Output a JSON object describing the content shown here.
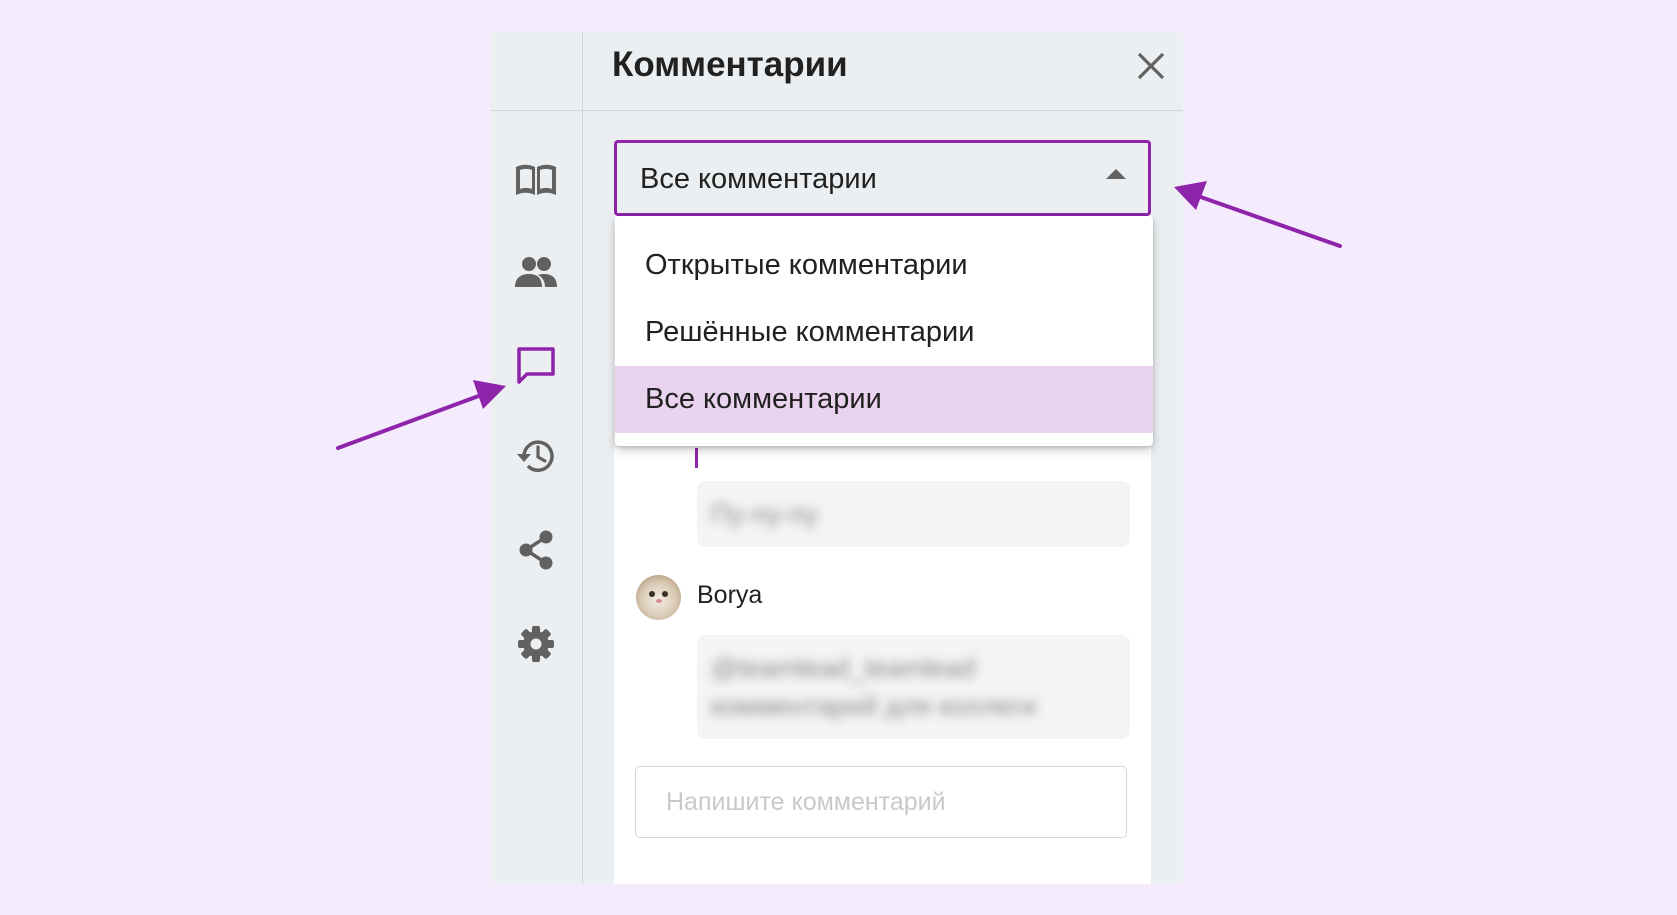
{
  "colors": {
    "page_background": "#f4ebfd",
    "accent": "#8e24aa",
    "selected_item": "#ead3ee",
    "icon": "#616161",
    "annotation_arrow": "#8e24aa"
  },
  "panel": {
    "title": "Комментарии",
    "close_icon": "close-icon"
  },
  "sidebar": {
    "items": [
      {
        "icon": "book-icon",
        "active": false
      },
      {
        "icon": "people-icon",
        "active": false
      },
      {
        "icon": "comment-icon",
        "active": true
      },
      {
        "icon": "history-icon",
        "active": false
      },
      {
        "icon": "share-icon",
        "active": false
      },
      {
        "icon": "settings-icon",
        "active": false
      }
    ]
  },
  "filter": {
    "selected": "Все комментарии",
    "options": [
      {
        "label": "Открытые комментарии",
        "selected": false
      },
      {
        "label": "Решённые комментарии",
        "selected": false
      },
      {
        "label": "Все комментарии",
        "selected": true
      }
    ]
  },
  "comments": [
    {
      "author": "",
      "text": "Пу-пу-пу",
      "blurred": true
    },
    {
      "author": "Borya",
      "text_lines": [
        "@teamlead_teamlead",
        "комментарий для коллеги"
      ],
      "blurred": true
    }
  ],
  "composer": {
    "placeholder": "Напишите комментарий"
  }
}
